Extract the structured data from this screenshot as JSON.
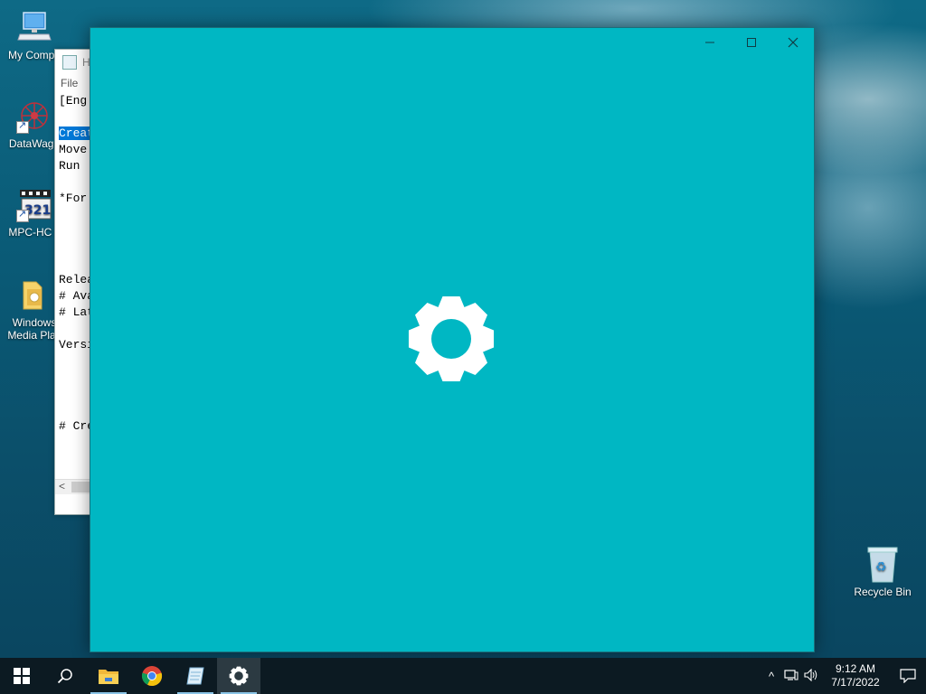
{
  "desktop": {
    "icons": [
      {
        "label": "My Compu",
        "icon": "computer-icon"
      },
      {
        "label": "DataWago",
        "icon": "datawagon-icon"
      },
      {
        "label": "MPC-HC x",
        "icon": "mpc-hc-icon"
      },
      {
        "label_line1": "Windows",
        "label_line2": "Media Play",
        "icon": "windows-media-player-icon"
      }
    ],
    "recycle_bin": {
      "label": "Recycle Bin",
      "icon": "recycle-bin-icon"
    }
  },
  "notepad": {
    "title": "H",
    "menu_file": "File",
    "lines": [
      {
        "text": "[Eng",
        "selected": false
      },
      {
        "text": "",
        "selected": false
      },
      {
        "text": "Creat",
        "selected": true
      },
      {
        "text": "Move",
        "selected": false
      },
      {
        "text": "Run '",
        "selected": false
      },
      {
        "text": "",
        "selected": false
      },
      {
        "text": "*For",
        "selected": false
      },
      {
        "text": "",
        "selected": false
      },
      {
        "text": "",
        "selected": false
      },
      {
        "text": "",
        "selected": false
      },
      {
        "text": "",
        "selected": false
      },
      {
        "text": "Relea",
        "selected": false
      },
      {
        "text": "# Ava",
        "selected": false
      },
      {
        "text": "# Lat",
        "selected": false
      },
      {
        "text": "",
        "selected": false
      },
      {
        "text": "Versi",
        "selected": false
      },
      {
        "text": "",
        "selected": false
      },
      {
        "text": "",
        "selected": false
      },
      {
        "text": "",
        "selected": false
      },
      {
        "text": "",
        "selected": false
      },
      {
        "text": "# Cre",
        "selected": false
      }
    ],
    "scroll_left_label": "<"
  },
  "settings_window": {
    "background": "#00b7c3",
    "controls": {
      "minimize": "—",
      "maximize": "☐",
      "close": "✕"
    },
    "splash_icon": "gear-icon"
  },
  "taskbar": {
    "items": [
      {
        "name": "start",
        "icon": "windows-start-icon",
        "active": false
      },
      {
        "name": "search",
        "icon": "search-icon",
        "active": false
      },
      {
        "name": "file-explorer",
        "icon": "folder-icon",
        "active": false,
        "running": true
      },
      {
        "name": "chrome",
        "icon": "chrome-icon",
        "active": false
      },
      {
        "name": "notepad",
        "icon": "notepad-icon",
        "active": false,
        "running": true
      },
      {
        "name": "settings",
        "icon": "gear-icon",
        "active": true,
        "running": true
      }
    ],
    "tray": {
      "chevron": "^",
      "network": "network-icon",
      "volume": "volume-icon"
    },
    "clock": {
      "time": "9:12 AM",
      "date": "7/17/2022"
    },
    "notification_icon": "notification-icon",
    "accent": "#8ac4e6"
  }
}
